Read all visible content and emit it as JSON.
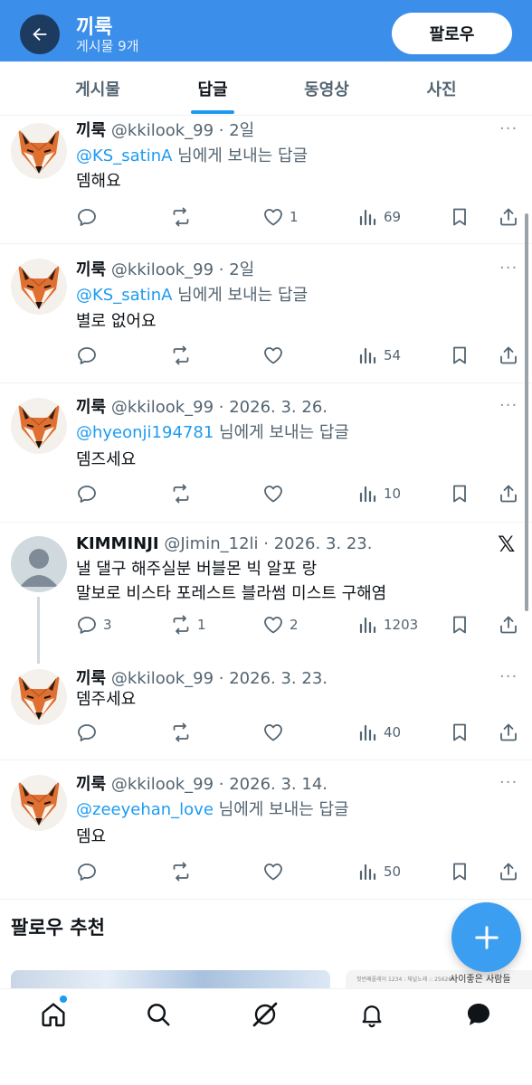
{
  "header": {
    "title": "끼룩",
    "subtitle": "게시물 9개",
    "follow_label": "팔로우"
  },
  "tabs": [
    {
      "label": "게시물"
    },
    {
      "label": "답글"
    },
    {
      "label": "동영상"
    },
    {
      "label": "사진"
    }
  ],
  "active_tab": "답글",
  "reply_suffix": "님에게 보내는 답글",
  "tweets": [
    {
      "name": "끼룩",
      "handle": "@kkilook_99 · 2일",
      "mention": "@KS_satinA",
      "lines": [
        "뎀해요"
      ],
      "replies": "",
      "retweets": "",
      "likes": "1",
      "views": "69"
    },
    {
      "name": "끼룩",
      "handle": "@kkilook_99 · 2일",
      "mention": "@KS_satinA",
      "lines": [
        "별로 없어요"
      ],
      "replies": "",
      "retweets": "",
      "likes": "",
      "views": "54"
    },
    {
      "name": "끼룩",
      "handle": "@kkilook_99 · 2026. 3. 26.",
      "mention": "@hyeonji194781",
      "lines": [
        "뎀즈세요"
      ],
      "replies": "",
      "retweets": "",
      "likes": "",
      "views": "10"
    },
    {
      "name": "KIMMINJI",
      "handle": "@Jimin_12li · 2026. 3. 23.",
      "mention": "",
      "lines": [
        "낼 댈구 해주실분 버블몬 빅 알포 랑",
        "말보로 비스타 포레스트 블라썸 미스트 구해염"
      ],
      "replies": "3",
      "retweets": "1",
      "likes": "2",
      "views": "1203"
    },
    {
      "name": "끼룩",
      "handle": "@kkilook_99 · 2026. 3. 23.",
      "mention": "",
      "lines": [
        "뎀주세요"
      ],
      "replies": "",
      "retweets": "",
      "likes": "",
      "views": "40"
    },
    {
      "name": "끼룩",
      "handle": "@kkilook_99 · 2026. 3. 14.",
      "mention": "@zeeyehan_love",
      "lines": [
        "뎀요"
      ],
      "replies": "",
      "retweets": "",
      "likes": "",
      "views": "50"
    }
  ],
  "more_glyph": "···",
  "x_logo": "𝕏",
  "follow_recommend": {
    "title": "팔로우 추천",
    "card_right_text": "사이좋은 사람들",
    "card_right_small": "첫번째플레이 1234 : 채널노래 :: 256267"
  },
  "icons": {
    "back": "arrow-left-icon",
    "reply": "speech-bubble-icon",
    "retweet": "retweet-icon",
    "like": "heart-icon",
    "views": "bar-chart-icon",
    "bookmark": "bookmark-icon",
    "share": "share-icon",
    "compose": "plus-icon",
    "nav": [
      "home-icon",
      "search-icon",
      "grok-icon",
      "bell-icon",
      "message-icon"
    ]
  },
  "colors": {
    "header_bg": "#3b8ee9",
    "accent": "#1d9bf0",
    "fab": "#3b9ef0"
  }
}
